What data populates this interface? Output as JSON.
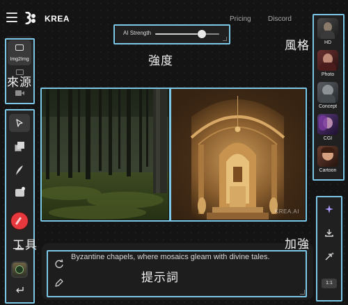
{
  "header": {
    "brand": "KREA",
    "nav": [
      {
        "label": "Pricing"
      },
      {
        "label": "Discord"
      }
    ]
  },
  "strength": {
    "label": "AI Strength",
    "value": 0.73
  },
  "source_panel": {
    "items": [
      {
        "label": "Img2Img",
        "icon": "image-icon",
        "active": true
      },
      {
        "label": "",
        "icon": "screen-share-icon"
      },
      {
        "label": "",
        "icon": "video-camera-icon"
      }
    ]
  },
  "tools": [
    {
      "icon": "cursor-icon"
    },
    {
      "icon": "shapes-icon"
    },
    {
      "icon": "brush-icon"
    },
    {
      "icon": "image-add-icon"
    },
    {
      "icon": "color-picker-icon",
      "color": "#e6383d"
    },
    {
      "icon": "eraser-icon"
    },
    {
      "icon": "reference-thumbnail"
    },
    {
      "icon": "undo-icon"
    }
  ],
  "styles": [
    {
      "label": "HD",
      "icon": "hd-style-thumbnail"
    },
    {
      "label": "Photo",
      "icon": "photo-style-thumbnail"
    },
    {
      "label": "Concept",
      "icon": "concept-style-thumbnail"
    },
    {
      "label": "CGI",
      "icon": "cgi-style-thumbnail"
    },
    {
      "label": "Cartoon",
      "icon": "cartoon-style-thumbnail"
    }
  ],
  "enhance": {
    "items": [
      {
        "icon": "sparkle-icon"
      },
      {
        "icon": "download-icon"
      },
      {
        "icon": "upscale-icon"
      }
    ],
    "ratio": "1:1"
  },
  "output": {
    "watermark": "KREA.AI"
  },
  "prompt": {
    "text": "Byzantine chapels, where mosaics gleam with divine tales."
  },
  "annotations": {
    "strength": "強度",
    "source": "來源",
    "style": "風格",
    "tools": "工具",
    "enhance": "加強",
    "prompt": "提示詞"
  },
  "colors": {
    "highlight": "#7cc8e8",
    "background": "#141414",
    "panel": "#242424",
    "accent_red": "#e6383d"
  }
}
